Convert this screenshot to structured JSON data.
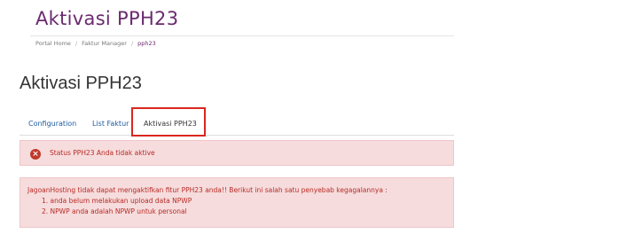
{
  "header": {
    "site_title": "Aktivasi PPH23"
  },
  "breadcrumb": {
    "items": [
      "Portal Home",
      "Faktur Manager",
      "pph23"
    ],
    "separator": "/"
  },
  "page": {
    "title": "Aktivasi PPH23"
  },
  "tabs": [
    {
      "label": "Configuration"
    },
    {
      "label": "List Faktur"
    },
    {
      "label": "Aktivasi PPH23",
      "active": true
    }
  ],
  "alerts": {
    "status": {
      "icon": "error-circle-icon",
      "icon_glyph": "×",
      "text": "Status PPH23 Anda tidak aktive"
    },
    "error": {
      "intro": "JagoanHosting tidak dapat mengaktifkan fitur PPH23 anda!! Berikut ini salah satu penyebab kegagalannya :",
      "reasons": [
        "1. anda belum melakukan upload data NPWP",
        "2. NPWP anda adalah NPWP untuk personal"
      ]
    }
  },
  "colors": {
    "brand": "#6b2a6f",
    "link": "#1d5aa0",
    "alert_bg": "#f6dcdd",
    "alert_text": "#b72c26",
    "highlight_border": "#d9271f"
  }
}
